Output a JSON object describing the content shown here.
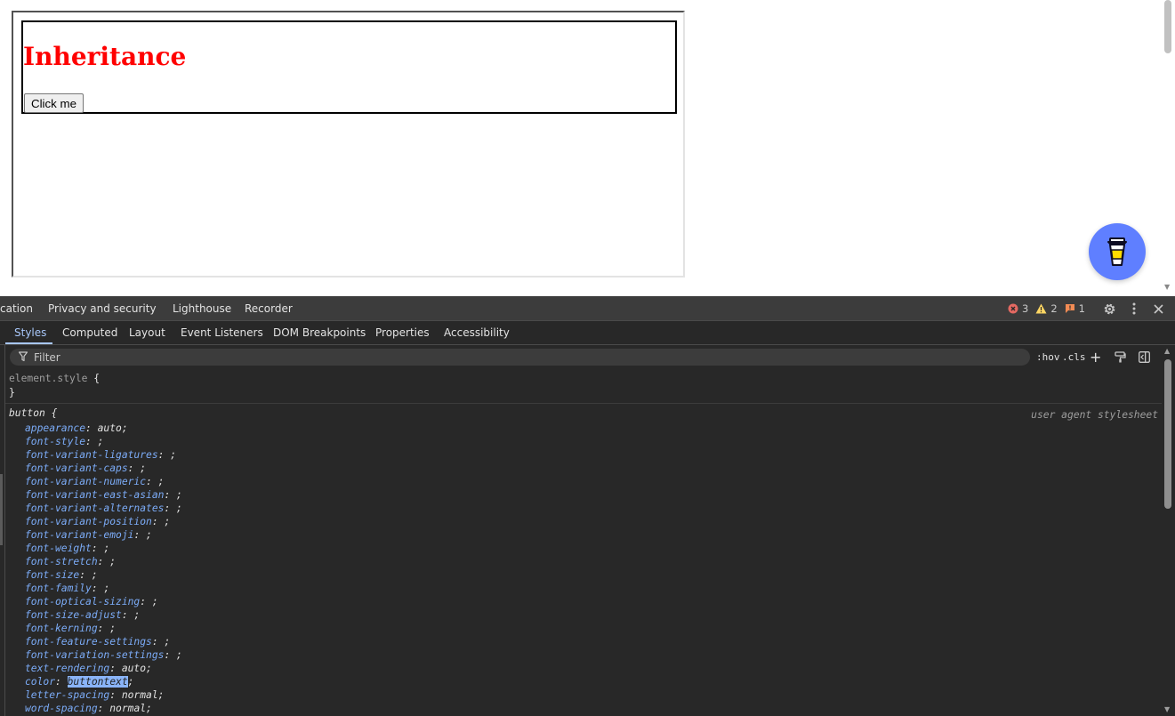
{
  "page": {
    "heading": "Inheritance",
    "button_label": "Click me",
    "colors": {
      "heading": "#ff0000",
      "coffee_button": "#5f7fff"
    },
    "coffee_icon": "coffee-cup-icon"
  },
  "devtools": {
    "main_tabs": [
      "cation",
      "Privacy and security",
      "Lighthouse",
      "Recorder"
    ],
    "status": {
      "errors": "3",
      "warnings": "2",
      "issues": "1"
    },
    "sub_tabs": [
      "Styles",
      "Computed",
      "Layout",
      "Event Listeners",
      "DOM Breakpoints",
      "Properties",
      "Accessibility"
    ],
    "filter_placeholder": "Filter",
    "toolbar": {
      "hov": ":hov",
      "cls": ".cls",
      "plus": "+"
    },
    "element_style": {
      "selector": "element.style",
      "open": "{",
      "close": "}"
    },
    "button_rule": {
      "selector": "button",
      "open": "{",
      "source": "user agent stylesheet",
      "declarations": [
        {
          "name": "appearance",
          "value": "auto"
        },
        {
          "name": "font-style",
          "value": ""
        },
        {
          "name": "font-variant-ligatures",
          "value": ""
        },
        {
          "name": "font-variant-caps",
          "value": ""
        },
        {
          "name": "font-variant-numeric",
          "value": ""
        },
        {
          "name": "font-variant-east-asian",
          "value": ""
        },
        {
          "name": "font-variant-alternates",
          "value": ""
        },
        {
          "name": "font-variant-position",
          "value": ""
        },
        {
          "name": "font-variant-emoji",
          "value": ""
        },
        {
          "name": "font-weight",
          "value": ""
        },
        {
          "name": "font-stretch",
          "value": ""
        },
        {
          "name": "font-size",
          "value": ""
        },
        {
          "name": "font-family",
          "value": ""
        },
        {
          "name": "font-optical-sizing",
          "value": ""
        },
        {
          "name": "font-size-adjust",
          "value": ""
        },
        {
          "name": "font-kerning",
          "value": ""
        },
        {
          "name": "font-feature-settings",
          "value": ""
        },
        {
          "name": "font-variation-settings",
          "value": ""
        },
        {
          "name": "text-rendering",
          "value": "auto"
        },
        {
          "name": "color",
          "value": "buttontext",
          "highlighted": true
        },
        {
          "name": "letter-spacing",
          "value": "normal"
        },
        {
          "name": "word-spacing",
          "value": "normal"
        }
      ]
    },
    "colors": {
      "property_name": "#7cacf8",
      "active_tab": "#a8c7fa",
      "error": "#e46962",
      "warning": "#fdd663",
      "issue": "#f28b54"
    }
  }
}
